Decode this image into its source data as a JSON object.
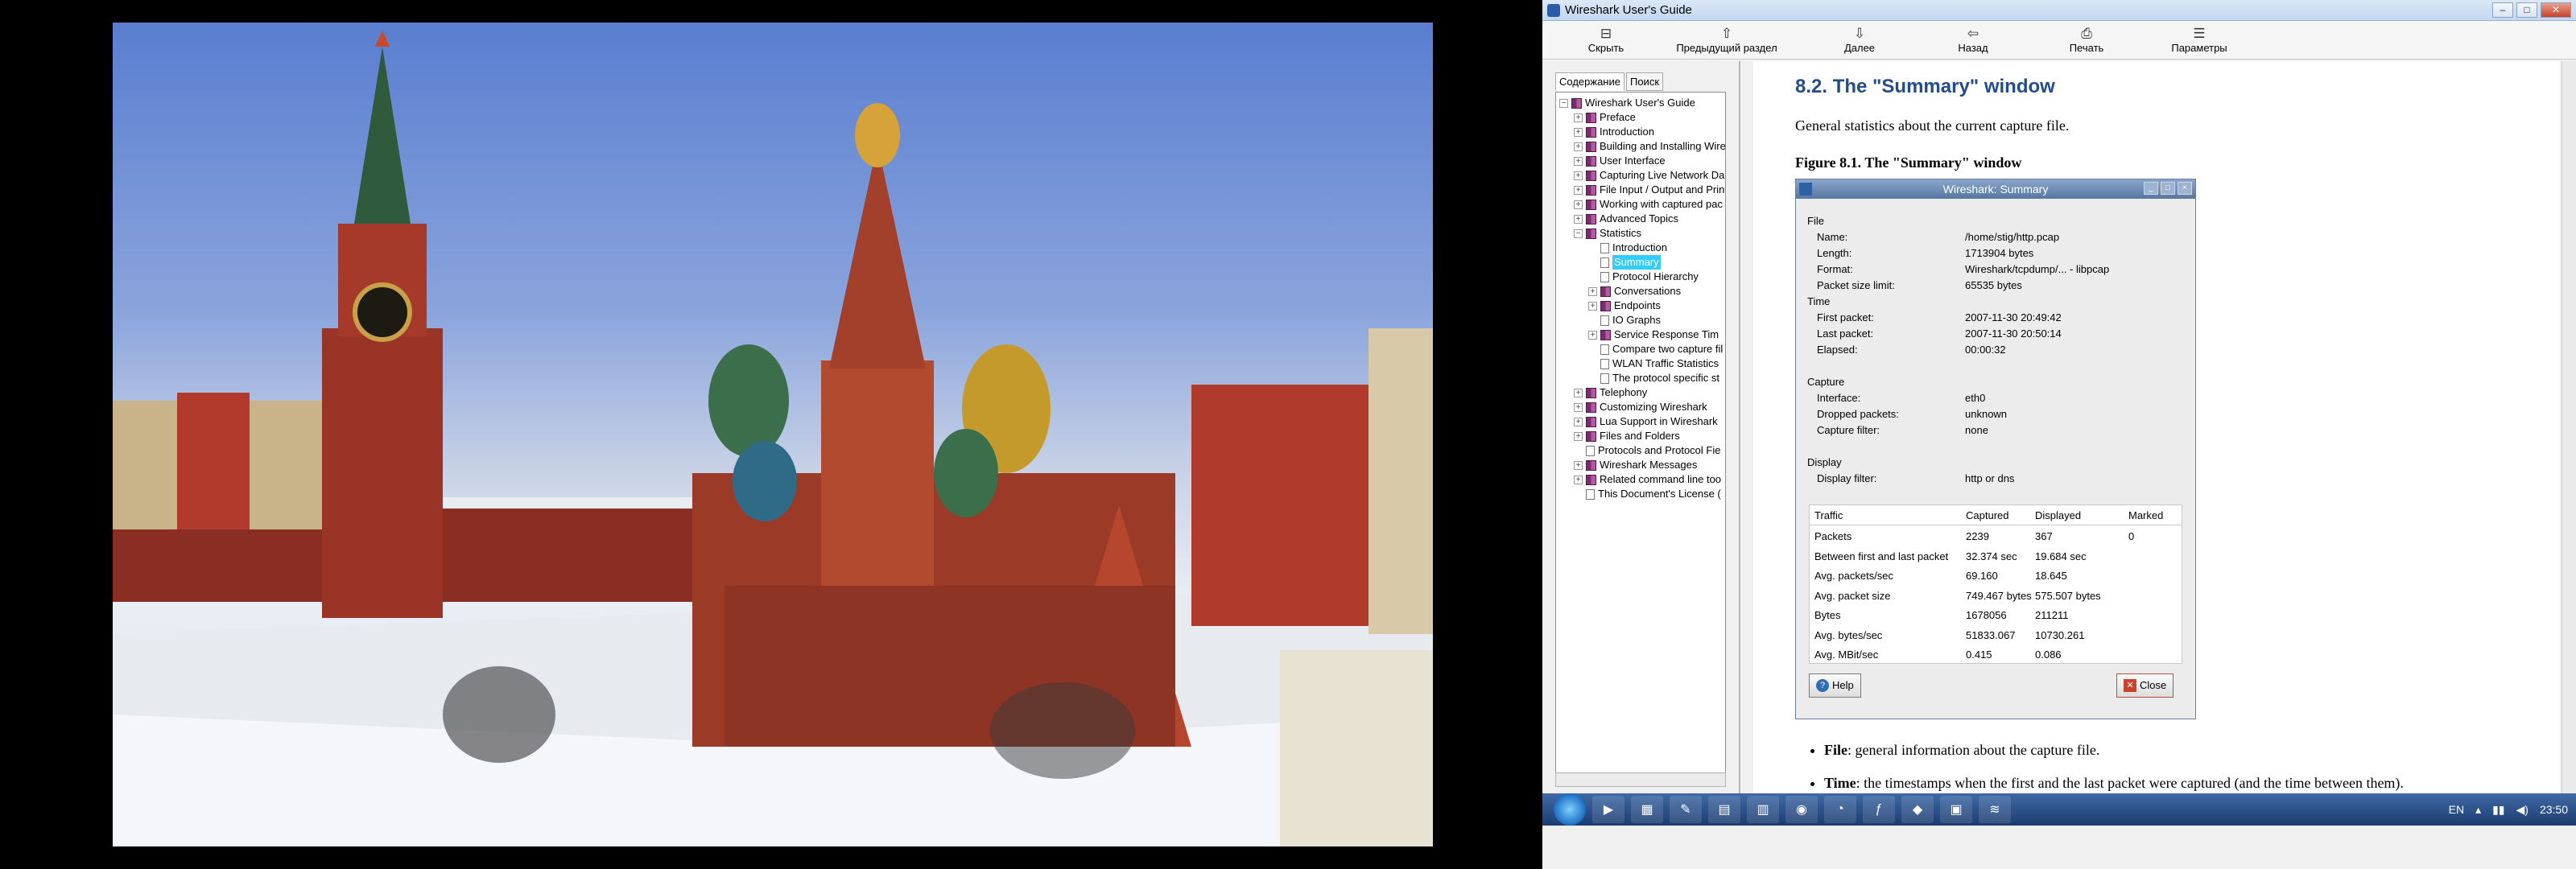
{
  "window": {
    "title": "Wireshark User's Guide",
    "minimize": "–",
    "maximize": "□",
    "close": "✕"
  },
  "toolbar": [
    {
      "label": "Скрыть",
      "icon": "hide-icon"
    },
    {
      "label": "Предыдущий раздел",
      "icon": "up-arrow-icon"
    },
    {
      "label": "Далее",
      "icon": "forward-icon"
    },
    {
      "label": "Назад",
      "icon": "back-icon"
    },
    {
      "label": "Печать",
      "icon": "print-icon"
    },
    {
      "label": "Параметры",
      "icon": "options-icon"
    }
  ],
  "nav": {
    "tabs": [
      "Содержание",
      "Поиск"
    ],
    "tree": [
      {
        "label": "Wireshark User's Guide",
        "level": 0,
        "expander": "−",
        "kind": "book"
      },
      {
        "label": "Preface",
        "level": 1,
        "expander": "+",
        "kind": "book"
      },
      {
        "label": "Introduction",
        "level": 1,
        "expander": "+",
        "kind": "book"
      },
      {
        "label": "Building and Installing Wire",
        "level": 1,
        "expander": "+",
        "kind": "book"
      },
      {
        "label": "User Interface",
        "level": 1,
        "expander": "+",
        "kind": "book"
      },
      {
        "label": "Capturing Live Network Da",
        "level": 1,
        "expander": "+",
        "kind": "book"
      },
      {
        "label": "File Input / Output and Print",
        "level": 1,
        "expander": "+",
        "kind": "book"
      },
      {
        "label": "Working with captured pac",
        "level": 1,
        "expander": "+",
        "kind": "book"
      },
      {
        "label": "Advanced Topics",
        "level": 1,
        "expander": "+",
        "kind": "book"
      },
      {
        "label": "Statistics",
        "level": 1,
        "expander": "−",
        "kind": "book"
      },
      {
        "label": "Introduction",
        "level": 2,
        "expander": "",
        "kind": "page"
      },
      {
        "label": "Summary",
        "level": 2,
        "expander": "",
        "kind": "page",
        "selected": true
      },
      {
        "label": "Protocol Hierarchy",
        "level": 2,
        "expander": "",
        "kind": "page"
      },
      {
        "label": "Conversations",
        "level": 2,
        "expander": "+",
        "kind": "book"
      },
      {
        "label": "Endpoints",
        "level": 2,
        "expander": "+",
        "kind": "book"
      },
      {
        "label": "IO Graphs",
        "level": 2,
        "expander": "",
        "kind": "page"
      },
      {
        "label": "Service Response Tim",
        "level": 2,
        "expander": "+",
        "kind": "book"
      },
      {
        "label": "Compare two capture fil",
        "level": 2,
        "expander": "",
        "kind": "page"
      },
      {
        "label": "WLAN Traffic Statistics",
        "level": 2,
        "expander": "",
        "kind": "page"
      },
      {
        "label": "The protocol specific st",
        "level": 2,
        "expander": "",
        "kind": "page"
      },
      {
        "label": "Telephony",
        "level": 1,
        "expander": "+",
        "kind": "book"
      },
      {
        "label": "Customizing Wireshark",
        "level": 1,
        "expander": "+",
        "kind": "book"
      },
      {
        "label": "Lua Support in Wireshark",
        "level": 1,
        "expander": "+",
        "kind": "book"
      },
      {
        "label": "Files and Folders",
        "level": 1,
        "expander": "+",
        "kind": "book"
      },
      {
        "label": "Protocols and Protocol Fie",
        "level": 1,
        "expander": "",
        "kind": "page"
      },
      {
        "label": "Wireshark Messages",
        "level": 1,
        "expander": "+",
        "kind": "book"
      },
      {
        "label": "Related command line too",
        "level": 1,
        "expander": "+",
        "kind": "book"
      },
      {
        "label": "This Document's License (",
        "level": 1,
        "expander": "",
        "kind": "page"
      }
    ]
  },
  "content": {
    "heading": "8.2. The \"Summary\" window",
    "lead": "General statistics about the current capture file.",
    "figure_title": "Figure 8.1. The \"Summary\" window",
    "dialog": {
      "title": "Wireshark: Summary",
      "file": {
        "header": "File",
        "rows": [
          [
            "Name:",
            "/home/stig/http.pcap"
          ],
          [
            "Length:",
            "1713904 bytes"
          ],
          [
            "Format:",
            "Wireshark/tcpdump/... - libpcap"
          ],
          [
            "Packet size limit:",
            "65535 bytes"
          ]
        ]
      },
      "time": {
        "header": "Time",
        "rows": [
          [
            "First packet:",
            "2007-11-30 20:49:42"
          ],
          [
            "Last packet:",
            "2007-11-30 20:50:14"
          ],
          [
            "Elapsed:",
            "00:00:32"
          ]
        ]
      },
      "capture": {
        "header": "Capture",
        "rows": [
          [
            "Interface:",
            "eth0"
          ],
          [
            "Dropped packets:",
            "unknown"
          ],
          [
            "Capture filter:",
            "none"
          ]
        ]
      },
      "display": {
        "header": "Display",
        "rows": [
          [
            "Display filter:",
            "http or dns"
          ]
        ]
      },
      "traffic": {
        "columns": [
          "Traffic",
          "Captured",
          "Displayed",
          "Marked"
        ],
        "rows": [
          [
            "Packets",
            "2239",
            "367",
            "0"
          ],
          [
            "Between first and last packet",
            "32.374 sec",
            "19.684 sec",
            ""
          ],
          [
            "Avg. packets/sec",
            "69.160",
            "18.645",
            ""
          ],
          [
            "Avg. packet size",
            "749.467 bytes",
            "575.507 bytes",
            ""
          ],
          [
            "Bytes",
            "1678056",
            "211211",
            ""
          ],
          [
            "Avg. bytes/sec",
            "51833.067",
            "10730.261",
            ""
          ],
          [
            "Avg. MBit/sec",
            "0.415",
            "0.086",
            ""
          ]
        ]
      },
      "help_label": "Help",
      "close_label": "Close"
    },
    "bullets": [
      {
        "term": "File",
        "text": ": general information about the capture file."
      },
      {
        "term": "Time",
        "text": ": the timestamps when the first and the last packet were captured (and the time between them)."
      }
    ]
  },
  "taskbar": {
    "lang": "EN",
    "clock": "23:50",
    "items": [
      "▶",
      "▦",
      "✎",
      "▤",
      "▥",
      "◉",
      "◔",
      "ƒ",
      "◆",
      "▣",
      "≋"
    ]
  }
}
